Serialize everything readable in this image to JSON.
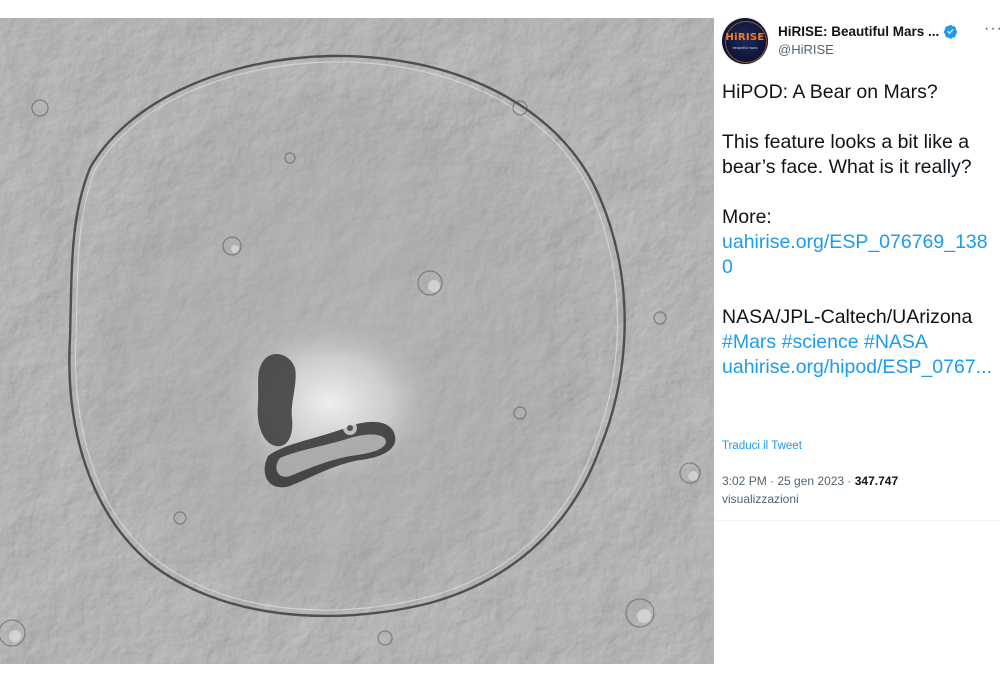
{
  "tweet": {
    "author": {
      "display_name": "HiRISE: Beautiful Mars ...",
      "handle": "@HiRISE",
      "verified": true,
      "avatar_text": "HiRISE",
      "avatar_subtext": "beautiful mars"
    },
    "more_menu": "···",
    "text": {
      "line1": "HiPOD: A Bear on Mars?",
      "line2": "This feature looks a bit like a bear’s face. What is it really?",
      "more_label": "More:",
      "link1": "uahirise.org/ESP_076769_1380",
      "credit": "NASA/JPL-Caltech/UArizona",
      "hashtags": "#Mars #science #NASA",
      "link2": "uahirise.org/hipod/ESP_0767..."
    },
    "translate_label": "Traduci il Tweet",
    "timestamp": "3:02 PM · 25 gen 2023 · ",
    "views_count": "347.747",
    "views_label": "visualizzazioni"
  },
  "colors": {
    "link": "#1d9bf0",
    "text": "#0f1419",
    "secondary": "#536471",
    "verified": "#1d9bf0",
    "avatar_accent": "#ff7a1a"
  }
}
